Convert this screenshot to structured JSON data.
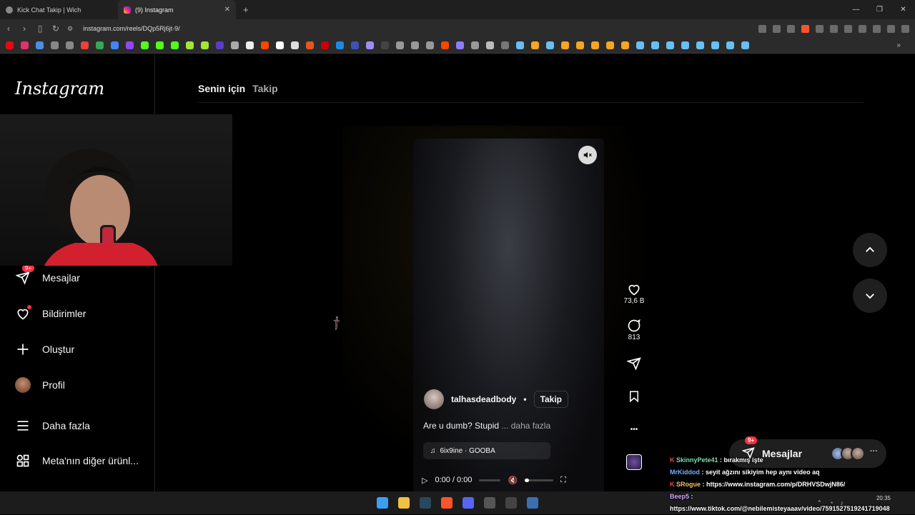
{
  "browser": {
    "tabs": [
      {
        "title": "Kick Chat Takip | Wich"
      },
      {
        "title": "(9) Instagram"
      }
    ],
    "url": "instagram.com/reels/DQp5Rj6jt-9/"
  },
  "instagram": {
    "logo": "Instagram",
    "nav": [
      {
        "label": "Mesajlar",
        "badge": "9+"
      },
      {
        "label": "Bildirimler"
      },
      {
        "label": "Oluştur"
      },
      {
        "label": "Profil"
      },
      {
        "label": "Daha fazla"
      },
      {
        "label": "Meta'nın diğer ürünl..."
      }
    ],
    "feed_tabs": {
      "active": "Senin için",
      "inactive": "Takip"
    },
    "reel": {
      "author": "talhasdeadbody",
      "separator": "•",
      "follow": "Takip",
      "caption": "Are u dumb? Stupid",
      "more": "... daha fazla",
      "music": "6ix9ine · GOOBA",
      "time": "0:00 / 0:00",
      "likes": "73,6 B",
      "comments": "813"
    },
    "messages_float": {
      "label": "Mesajlar",
      "badge": "9+"
    }
  },
  "chat": [
    {
      "user": "SkinnyPete41",
      "text": ": bırakmış işte"
    },
    {
      "user": "MrKiddod",
      "text": ": seyit ağzını sikiyim hep aynı video aq"
    },
    {
      "user": "SRogue",
      "text": ": https://www.instagram.com/p/DRHVSDwjN86/"
    },
    {
      "user": "Beep5",
      "text": ":"
    },
    {
      "user": "",
      "text": "https://www.tiktok.com/@nebilemisteyaaav/video/7591527519241719048"
    }
  ],
  "clock": {
    "time": "20:35"
  },
  "colors": {
    "accent": "#ff3040",
    "brave": "#fb542b"
  }
}
